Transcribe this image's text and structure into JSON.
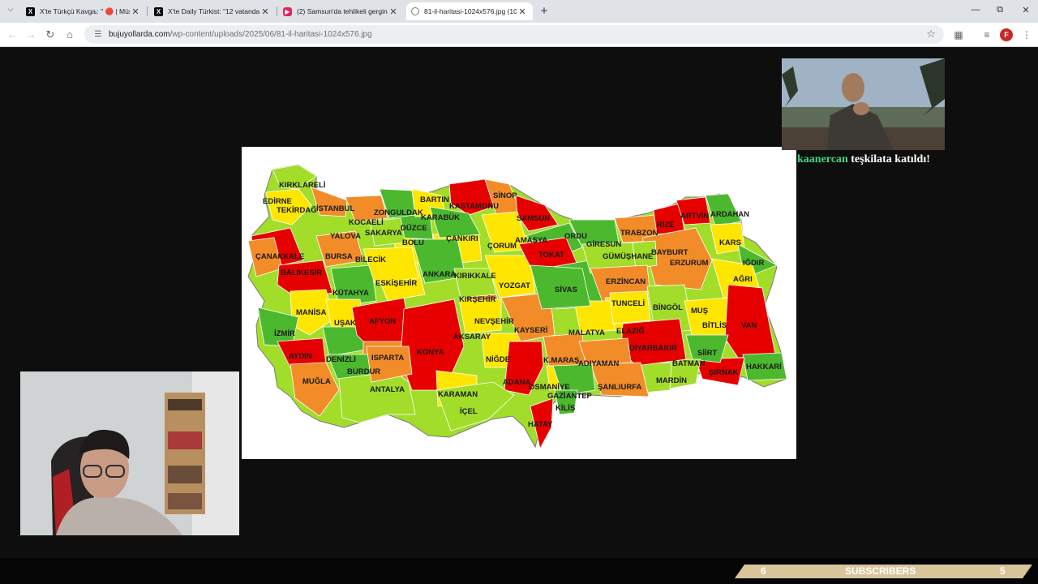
{
  "browser": {
    "tabs": [
      {
        "title": "X'te Türkçü Kavgaᵢ: \" 🔴 | Müstai",
        "icon": "x-logo-icon"
      },
      {
        "title": "X'te Daily Türkist: \"12 vatandaşı",
        "icon": "x-logo-icon"
      },
      {
        "title": "(2) Samsun'da tehlikeli gerginlik",
        "icon": "youtube-icon"
      },
      {
        "title": "81-il-haritasi-1024x576.jpg (102",
        "icon": "globe-icon"
      }
    ],
    "url_domain": "bujuyollarda.com",
    "url_path": "/wp-content/uploads/2025/06/81-il-haritasi-1024x576.jpg"
  },
  "map": {
    "provinces": [
      "KIRKLARELİ",
      "EDİRNE",
      "TEKİRDAĞ",
      "İSTANBUL",
      "KOCAELİ",
      "YALOVA",
      "ÇANAKKALE",
      "BURSA",
      "BİLECİK",
      "BALIKESİR",
      "ZONGULDAK",
      "BARTIN",
      "KARABÜK",
      "KASTAMONU",
      "SİNOP",
      "SAMSUN",
      "DÜZCE",
      "SAKARYA",
      "BOLU",
      "ÇANKIRI",
      "ÇORUM",
      "AMASYA",
      "ORDU",
      "GİRESUN",
      "TRABZON",
      "RİZE",
      "ARTVİN",
      "ARDAHAN",
      "KARS",
      "IĞDIR",
      "AĞRI",
      "TOKAT",
      "GÜMÜŞHANE",
      "BAYBURT",
      "ERZURUM",
      "ESKİŞEHİR",
      "ANKARA",
      "KIRIKKALE",
      "YOZGAT",
      "SİVAS",
      "ERZİNCAN",
      "KÜTAHYA",
      "KIRŞEHİR",
      "TUNCELİ",
      "BİNGÖL",
      "MUŞ",
      "MANİSA",
      "UŞAK",
      "AFYON",
      "NEVŞEHİR",
      "KAYSERİ",
      "MALATYA",
      "ELAZIĞ",
      "BİTLİS",
      "VAN",
      "İZMİR",
      "AKSARAY",
      "KONYA",
      "AYDIN",
      "DENİZLİ",
      "ISPARTA",
      "NİĞDE",
      "K.MARAŞ",
      "ADIYAMAN",
      "DİYARBAKIR",
      "SİİRT",
      "BATMAN",
      "HAKKARİ",
      "ŞIRNAK",
      "MUĞLA",
      "BURDUR",
      "ANTALYA",
      "KARAMAN",
      "İÇEL",
      "ADANA",
      "OSMANİYE",
      "GAZİANTEP",
      "ŞANLIURFA",
      "MARDİN",
      "KİLİS",
      "HATAY"
    ],
    "colors": {
      "red": "#e60000",
      "orange": "#f28c28",
      "yellow": "#ffe600",
      "lightgreen": "#a2dd2a",
      "green": "#4cb82e"
    }
  },
  "overlay": {
    "alert_user": "kaanercan",
    "alert_message": "teşkilata katıldı!"
  },
  "subscribers": {
    "left_count": "6",
    "label": "SUBSCRIBERS",
    "right_count": "5"
  }
}
